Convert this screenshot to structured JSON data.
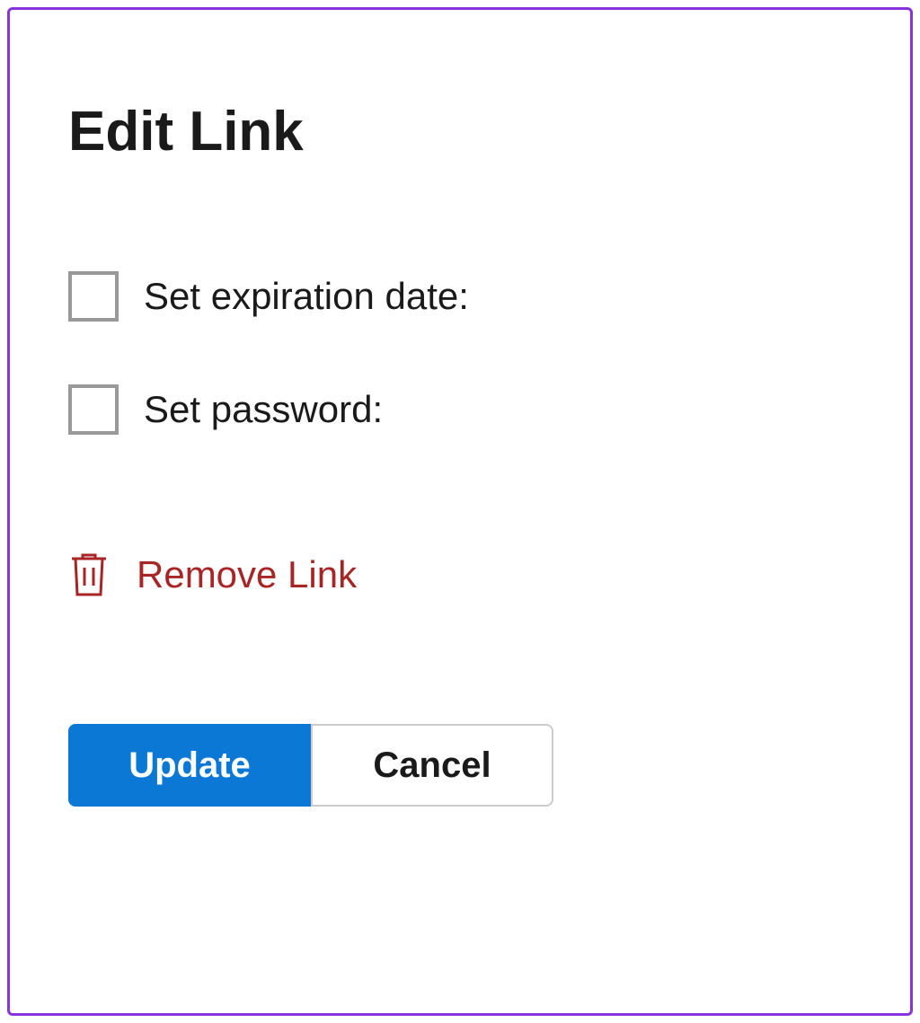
{
  "dialog": {
    "title": "Edit Link",
    "options": {
      "set_expiration_label": "Set expiration date:",
      "set_password_label": "Set password:"
    },
    "remove_link_label": "Remove Link",
    "buttons": {
      "update_label": "Update",
      "cancel_label": "Cancel"
    }
  },
  "colors": {
    "accent": "#0a78d4",
    "danger": "#a92424",
    "frame": "#8833dd"
  }
}
